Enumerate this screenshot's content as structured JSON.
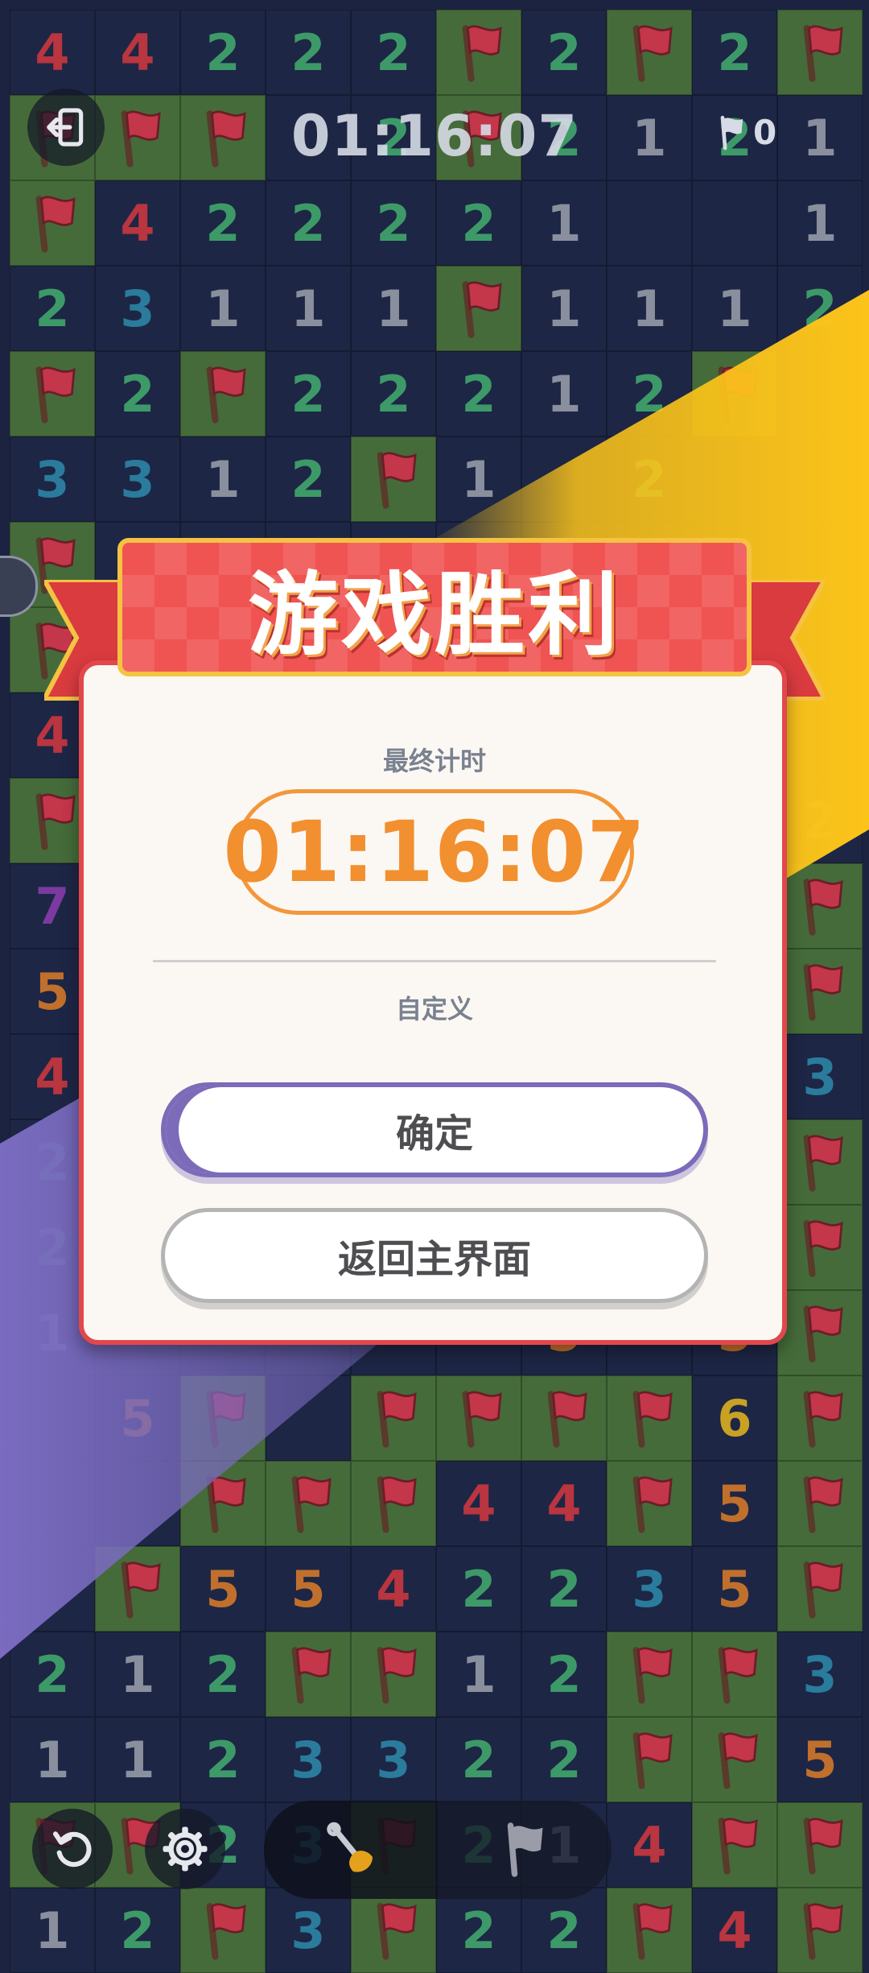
{
  "colors": {
    "board_bg": "#1b2340",
    "hidden_cell": "#1d2645",
    "flag_cell": "#456b3a",
    "flag_red": "#c4364a",
    "yellow_band": "#fcc41a",
    "purple_band": "#7a6bc0",
    "dialog_border": "#e2474c",
    "timer_orange": "#f28f2f",
    "confirm_purple": "#7b6bb9",
    "num_1": "#8a8f9e",
    "num_2": "#3d9a68",
    "num_3": "#2a7b9c",
    "num_4": "#b9353f",
    "num_5": "#c0702c",
    "num_6": "#c9a224",
    "num_7": "#7a3aa0"
  },
  "board": {
    "rows": [
      [
        "4",
        "4",
        "2",
        "2",
        "2",
        "F",
        "2",
        "F",
        "2",
        "F"
      ],
      [
        "F",
        "F",
        "F",
        "H",
        "2",
        "F",
        "2",
        "1",
        "2",
        "1"
      ],
      [
        "F",
        "4",
        "2",
        "2",
        "2",
        "2",
        "1",
        "H",
        "H",
        "1"
      ],
      [
        "2",
        "3",
        "1",
        "1",
        "1",
        "F",
        "1",
        "1",
        "1",
        "2"
      ],
      [
        "F",
        "2",
        "F",
        "2",
        "2",
        "2",
        "1",
        "2",
        "F",
        "H"
      ],
      [
        "3",
        "3",
        "1",
        "2",
        "F",
        "1",
        "H",
        "2",
        "H",
        "H"
      ],
      [
        "F",
        "H",
        "H",
        "H",
        "H",
        "H",
        "H",
        "H",
        "H",
        "H"
      ],
      [
        "F",
        "H",
        "H",
        "H",
        "H",
        "H",
        "H",
        "H",
        "H",
        "H"
      ],
      [
        "4",
        "H",
        "H",
        "H",
        "H",
        "H",
        "H",
        "H",
        "H",
        "H"
      ],
      [
        "F",
        "H",
        "H",
        "H",
        "H",
        "H",
        "H",
        "H",
        "H",
        "2"
      ],
      [
        "7",
        "H",
        "H",
        "H",
        "H",
        "H",
        "H",
        "H",
        "H",
        "F"
      ],
      [
        "5",
        "H",
        "H",
        "H",
        "H",
        "H",
        "H",
        "H",
        "H",
        "F"
      ],
      [
        "4",
        "H",
        "H",
        "H",
        "H",
        "H",
        "H",
        "H",
        "H",
        "3"
      ],
      [
        "2",
        "H",
        "H",
        "H",
        "H",
        "H",
        "H",
        "H",
        "H",
        "F"
      ],
      [
        "2",
        "H",
        "H",
        "H",
        "H",
        "H",
        "H",
        "H",
        "H",
        "F"
      ],
      [
        "1",
        "H",
        "H",
        "H",
        "H",
        "H",
        "5",
        "H",
        "5",
        "F"
      ],
      [
        "H",
        "5",
        "F",
        "H",
        "F",
        "F",
        "F",
        "F",
        "6",
        "F"
      ],
      [
        "H",
        "H",
        "F",
        "F",
        "F",
        "4",
        "4",
        "F",
        "5",
        "F"
      ],
      [
        "H",
        "F",
        "5",
        "5",
        "4",
        "2",
        "2",
        "3",
        "5",
        "F"
      ],
      [
        "2",
        "1",
        "2",
        "F",
        "F",
        "1",
        "2",
        "F",
        "F",
        "3"
      ],
      [
        "1",
        "1",
        "2",
        "3",
        "3",
        "2",
        "2",
        "F",
        "F",
        "5"
      ],
      [
        "F",
        "F",
        "2",
        "3",
        "F",
        "2",
        "1",
        "4",
        "F",
        "F"
      ],
      [
        "1",
        "2",
        "F",
        "3",
        "F",
        "2",
        "2",
        "F",
        "4",
        "F"
      ]
    ]
  },
  "hud": {
    "timer": "01:16:07",
    "flags_count": "0",
    "exit_icon": "exit-icon",
    "flag_counter_icon": "flag-icon"
  },
  "dialog": {
    "title": "游戏胜利",
    "final_time_label": "最终计时",
    "final_time": "01:16:07",
    "mode_label": "自定义",
    "confirm_label": "确定",
    "home_label": "返回主界面"
  },
  "toolbar": {
    "undo_icon": "undo-icon",
    "settings_icon": "gear-icon",
    "dig_icon": "shovel-icon",
    "flag_icon": "flag-icon"
  }
}
